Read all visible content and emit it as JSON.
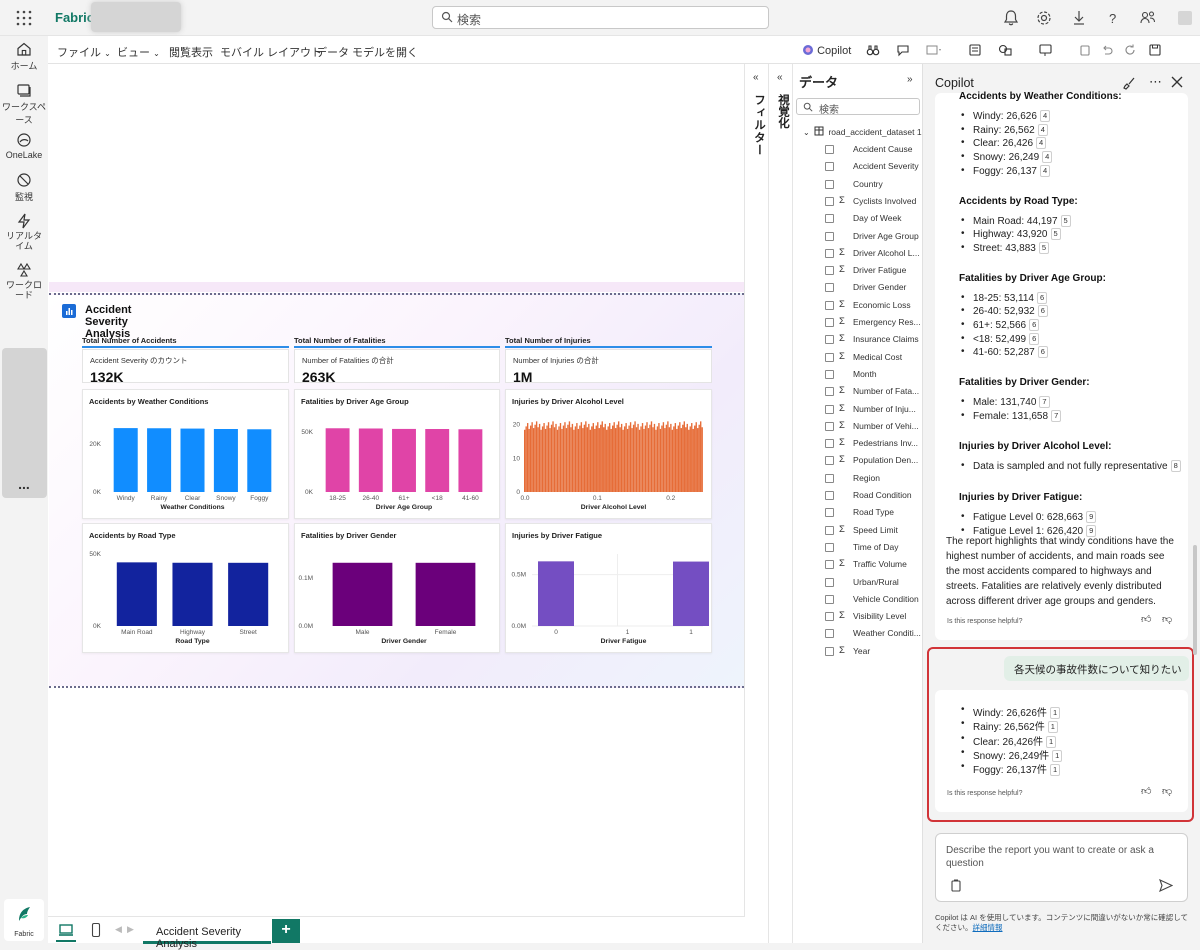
{
  "app": {
    "brand": "Fabric",
    "search_placeholder": "検索"
  },
  "rail": {
    "items": [
      {
        "label": "ホーム",
        "icon": "home-icon"
      },
      {
        "label": "ワークスペース",
        "icon": "workspaces-icon"
      },
      {
        "label": "OneLake",
        "icon": "onelake-icon"
      },
      {
        "label": "監視",
        "icon": "monitor-icon"
      },
      {
        "label": "リアルタイム",
        "icon": "realtime-icon"
      },
      {
        "label": "ワークロード",
        "icon": "workloads-icon"
      }
    ],
    "more": "...",
    "bottom_label": "Fabric"
  },
  "ribbon": {
    "file": "ファイル",
    "view": "ビュー",
    "reading_view": "閲覧表示",
    "mobile_layout": "モバイル レイアウト",
    "open_model": "データ モデルを開く",
    "copilot": "Copilot"
  },
  "report": {
    "title": "Accident Severity Analysis",
    "kpis": [
      {
        "header": "Total Number of Accidents",
        "label": "Accident Severity のカウント",
        "value": "132K"
      },
      {
        "header": "Total Number of Fatalities",
        "label": "Number of Fatalities の合計",
        "value": "263K"
      },
      {
        "header": "Total Number of Injuries",
        "label": "Number of Injuries の合計",
        "value": "1M"
      }
    ]
  },
  "chart_data": [
    {
      "type": "bar",
      "title": "Accidents by Weather Conditions",
      "xlabel": "Weather Conditions",
      "ylabel": "",
      "categories": [
        "Windy",
        "Rainy",
        "Clear",
        "Snowy",
        "Foggy"
      ],
      "values": [
        26626,
        26562,
        26426,
        26249,
        26137
      ],
      "yticks": [
        "0K",
        "20K"
      ],
      "ylim": [
        0,
        30000
      ],
      "color": "#118dff"
    },
    {
      "type": "bar",
      "title": "Fatalities by Driver Age Group",
      "xlabel": "Driver Age Group",
      "ylabel": "",
      "categories": [
        "18-25",
        "26-40",
        "61+",
        "<18",
        "41-60"
      ],
      "values": [
        53114,
        52932,
        52566,
        52499,
        52287
      ],
      "yticks": [
        "0K",
        "50K"
      ],
      "ylim": [
        0,
        60000
      ],
      "color": "#e044a7"
    },
    {
      "type": "bar",
      "title": "Injuries by Driver Alcohol Level",
      "xlabel": "Driver Alcohol Level",
      "ylabel": "",
      "xticks": [
        "0.0",
        "0.1",
        "0.2"
      ],
      "yticks": [
        "0",
        "10",
        "20"
      ],
      "ylim": [
        0,
        22
      ],
      "color": "#e66c37"
    },
    {
      "type": "bar",
      "title": "Accidents by Road Type",
      "xlabel": "Road Type",
      "ylabel": "",
      "categories": [
        "Main Road",
        "Highway",
        "Street"
      ],
      "values": [
        44197,
        43920,
        43883
      ],
      "yticks": [
        "0K",
        "50K"
      ],
      "ylim": [
        0,
        50000
      ],
      "color": "#12239e"
    },
    {
      "type": "bar",
      "title": "Fatalities by Driver Gender",
      "xlabel": "Driver Gender",
      "ylabel": "",
      "categories": [
        "Male",
        "Female"
      ],
      "values": [
        131740,
        131658
      ],
      "yticks": [
        "0.0M",
        "0.1M"
      ],
      "ylim": [
        0,
        150000
      ],
      "color": "#6b007b"
    },
    {
      "type": "bar",
      "title": "Injuries by Driver Fatigue",
      "xlabel": "Driver Fatigue",
      "ylabel": "",
      "categories": [
        "0",
        "1"
      ],
      "values": [
        628663,
        626420
      ],
      "xticks": [
        "0",
        "1",
        "1"
      ],
      "yticks": [
        "0.0M",
        "0.5M"
      ],
      "ylim": [
        0,
        700000
      ],
      "color": "#744ec2"
    }
  ],
  "tabs": {
    "page": "Accident Severity Analysis",
    "add": "+"
  },
  "filters_label": "フィルター",
  "viz_label": "視覚化",
  "data": {
    "title": "データ",
    "search_placeholder": "検索",
    "table": "road_accident_dataset 1",
    "fields": [
      {
        "name": "Accident Cause",
        "sigma": ""
      },
      {
        "name": "Accident Severity",
        "sigma": ""
      },
      {
        "name": "Country",
        "sigma": ""
      },
      {
        "name": "Cyclists Involved",
        "sigma": "Σ"
      },
      {
        "name": "Day of Week",
        "sigma": ""
      },
      {
        "name": "Driver Age Group",
        "sigma": ""
      },
      {
        "name": "Driver Alcohol L...",
        "sigma": "Σ"
      },
      {
        "name": "Driver Fatigue",
        "sigma": "Σ"
      },
      {
        "name": "Driver Gender",
        "sigma": ""
      },
      {
        "name": "Economic Loss",
        "sigma": "Σ"
      },
      {
        "name": "Emergency Res...",
        "sigma": "Σ"
      },
      {
        "name": "Insurance Claims",
        "sigma": "Σ"
      },
      {
        "name": "Medical Cost",
        "sigma": "Σ"
      },
      {
        "name": "Month",
        "sigma": ""
      },
      {
        "name": "Number of Fata...",
        "sigma": "Σ"
      },
      {
        "name": "Number of Inju...",
        "sigma": "Σ"
      },
      {
        "name": "Number of Vehi...",
        "sigma": "Σ"
      },
      {
        "name": "Pedestrians Inv...",
        "sigma": "Σ"
      },
      {
        "name": "Population Den...",
        "sigma": "Σ"
      },
      {
        "name": "Region",
        "sigma": ""
      },
      {
        "name": "Road Condition",
        "sigma": ""
      },
      {
        "name": "Road Type",
        "sigma": ""
      },
      {
        "name": "Speed Limit",
        "sigma": "Σ"
      },
      {
        "name": "Time of Day",
        "sigma": ""
      },
      {
        "name": "Traffic Volume",
        "sigma": "Σ"
      },
      {
        "name": "Urban/Rural",
        "sigma": ""
      },
      {
        "name": "Vehicle Condition",
        "sigma": ""
      },
      {
        "name": "Visibility Level",
        "sigma": "Σ"
      },
      {
        "name": "Weather Conditi...",
        "sigma": ""
      },
      {
        "name": "Year",
        "sigma": "Σ"
      }
    ]
  },
  "copilot": {
    "title": "Copilot",
    "sections": [
      {
        "heading": "Accidents by Weather Conditions",
        "items": [
          {
            "t": "Windy: 26,626",
            "b": "4"
          },
          {
            "t": "Rainy: 26,562",
            "b": "4"
          },
          {
            "t": "Clear: 26,426",
            "b": "4"
          },
          {
            "t": "Snowy: 26,249",
            "b": "4"
          },
          {
            "t": "Foggy: 26,137",
            "b": "4"
          }
        ]
      },
      {
        "heading": "Accidents by Road Type",
        "items": [
          {
            "t": "Main Road: 44,197",
            "b": "5"
          },
          {
            "t": "Highway: 43,920",
            "b": "5"
          },
          {
            "t": "Street: 43,883",
            "b": "5"
          }
        ]
      },
      {
        "heading": "Fatalities by Driver Age Group",
        "items": [
          {
            "t": "18-25: 53,114",
            "b": "6"
          },
          {
            "t": "26-40: 52,932",
            "b": "6"
          },
          {
            "t": "61+: 52,566",
            "b": "6"
          },
          {
            "t": "<18: 52,499",
            "b": "6"
          },
          {
            "t": "41-60: 52,287",
            "b": "6"
          }
        ]
      },
      {
        "heading": "Fatalities by Driver Gender",
        "items": [
          {
            "t": "Male: 131,740",
            "b": "7"
          },
          {
            "t": "Female: 131,658",
            "b": "7"
          }
        ]
      },
      {
        "heading": "Injuries by Driver Alcohol Level",
        "items": [
          {
            "t": "Data is sampled and not fully representative",
            "b": "8"
          }
        ]
      },
      {
        "heading": "Injuries by Driver Fatigue",
        "items": [
          {
            "t": "Fatigue Level 0: 628,663",
            "b": "9"
          },
          {
            "t": "Fatigue Level 1: 626,420",
            "b": "9"
          }
        ]
      }
    ],
    "summary": "The report highlights that windy conditions have the highest number of accidents, and main roads see the most accidents compared to highways and streets. Fatalities are relatively evenly distributed across different driver age groups and genders.",
    "helpful": "Is this response helpful?",
    "user_message": "各天候の事故件数について知りたい",
    "answer_items": [
      {
        "t": "Windy: 26,626件",
        "b": "1"
      },
      {
        "t": "Rainy: 26,562件",
        "b": "1"
      },
      {
        "t": "Clear: 26,426件",
        "b": "1"
      },
      {
        "t": "Snowy: 26,249件",
        "b": "1"
      },
      {
        "t": "Foggy: 26,137件",
        "b": "1"
      }
    ],
    "input_placeholder": "Describe the report you want to create or ask a question",
    "disclaimer": "Copilot は AI を使用しています。コンテンツに間違いがないか常に確認してください。",
    "details_link": "詳細情報"
  }
}
